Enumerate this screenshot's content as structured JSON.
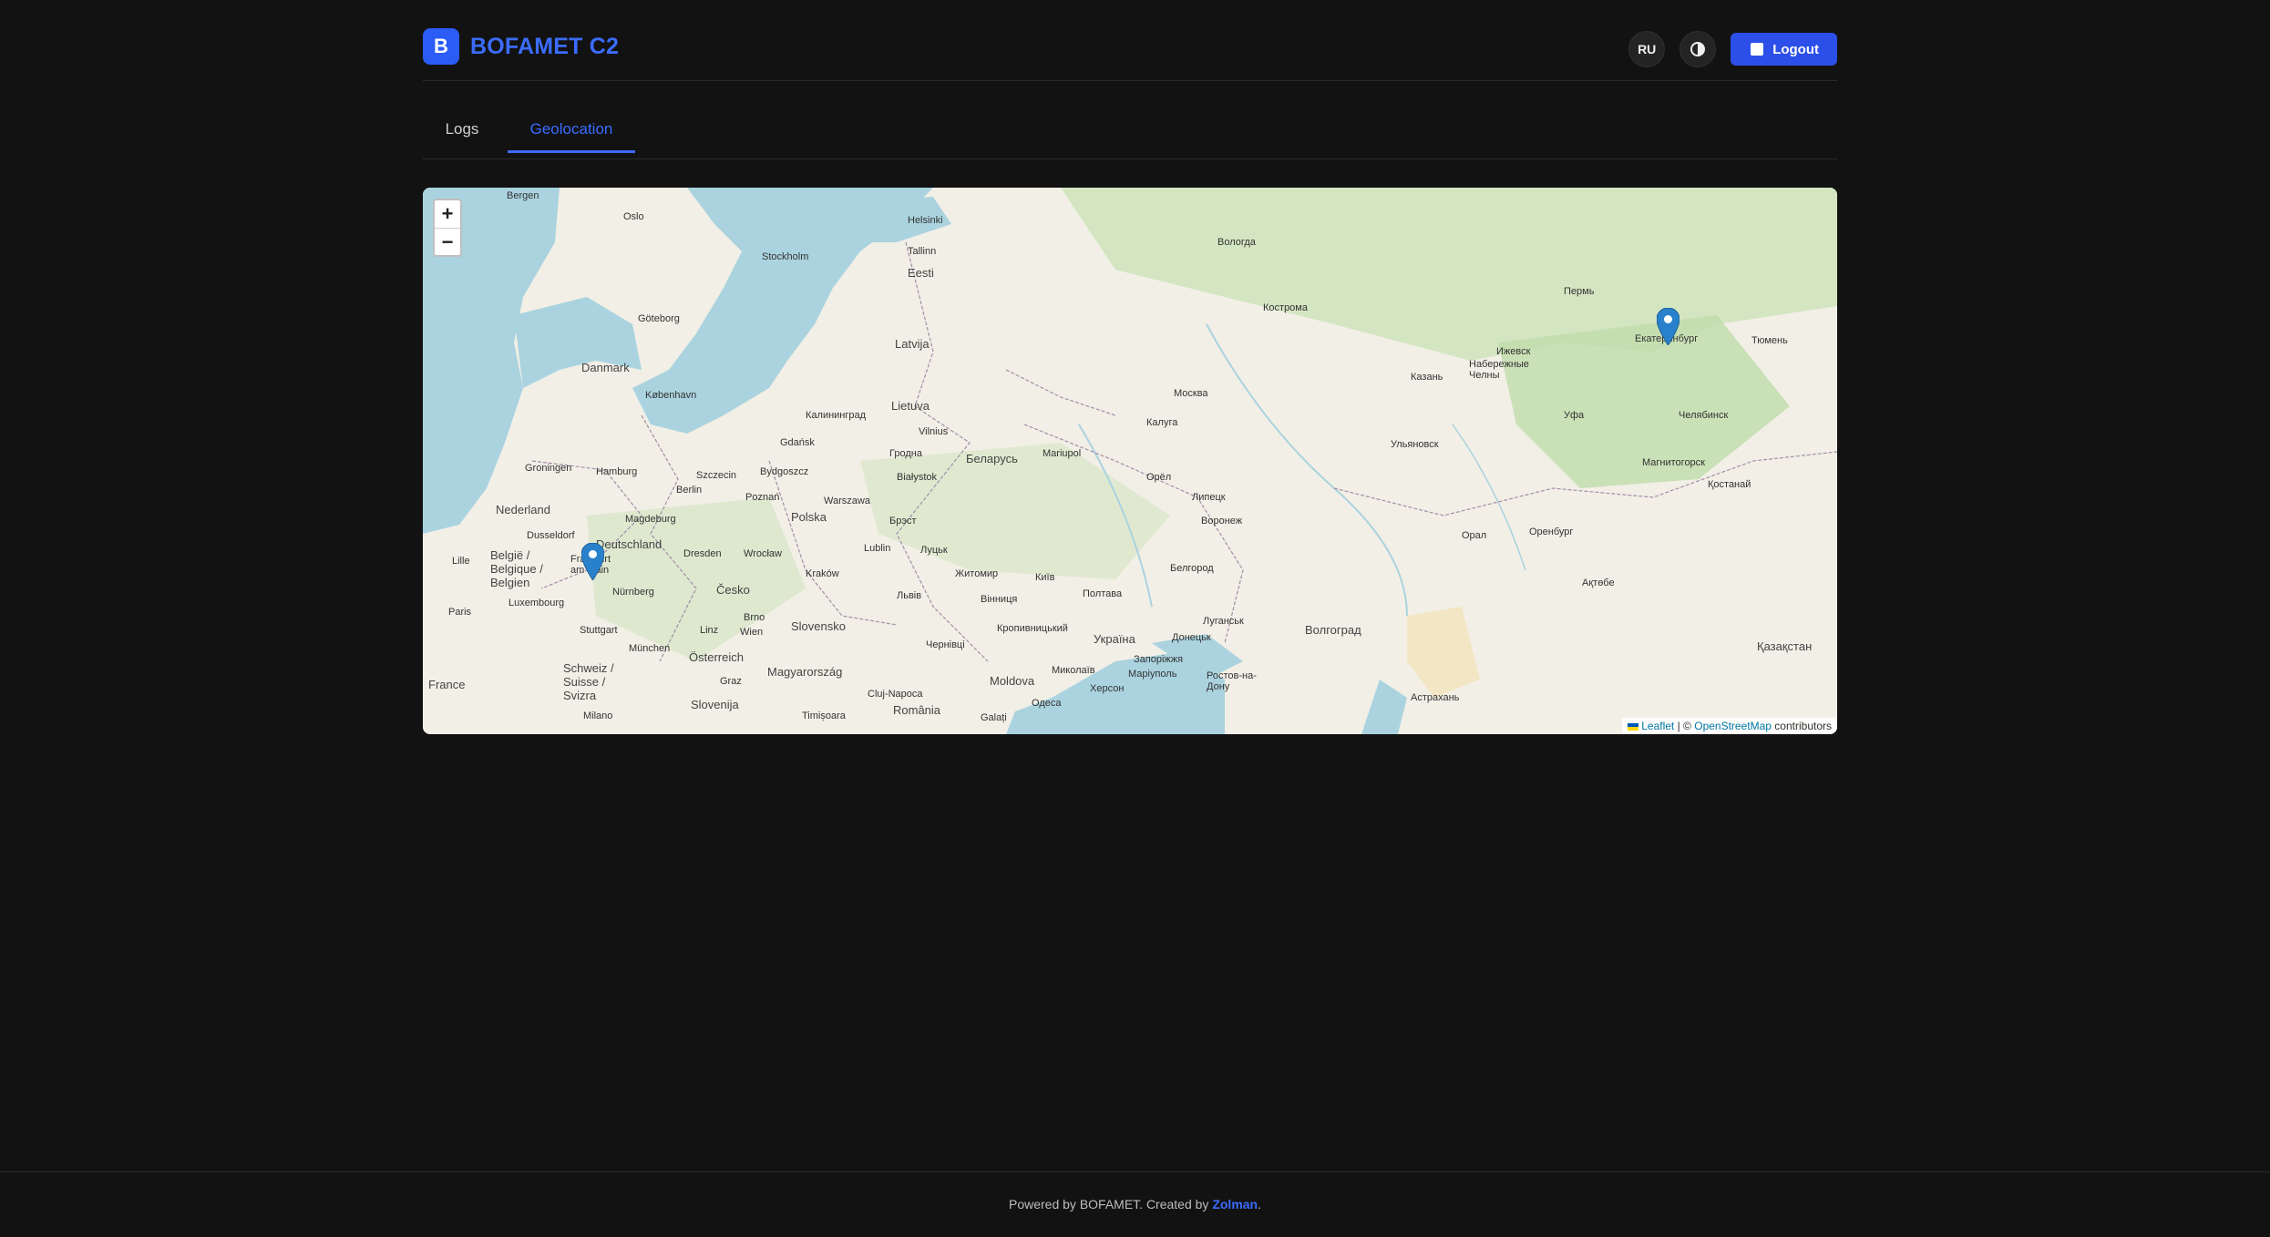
{
  "brand": {
    "badge": "B",
    "title": "BOFAMET C2"
  },
  "header": {
    "lang_button": "RU",
    "theme_toggle": "theme-toggle",
    "logout_label": "Logout"
  },
  "tabs": [
    {
      "label": "Logs",
      "active": false
    },
    {
      "label": "Geolocation",
      "active": true
    }
  ],
  "map": {
    "zoom_in": "+",
    "zoom_out": "−",
    "attribution": {
      "leaflet": "Leaflet",
      "sep": "| ©",
      "osm": "OpenStreetMap",
      "suffix": "contributors"
    },
    "markers": [
      {
        "near": "Frankfurt am Main"
      },
      {
        "near": "Екатеринбург"
      }
    ],
    "labels": {
      "bergen": "Bergen",
      "oslo": "Oslo",
      "stockholm": "Stockholm",
      "helsinki": "Helsinki",
      "tallinn": "Tallinn",
      "eesti": "Eesti",
      "goteborg": "Göteborg",
      "latvija": "Latvija",
      "danmark": "Danmark",
      "kobenhavn": "København",
      "lietuva": "Lietuva",
      "vilnius": "Vilnius",
      "kaliningrad": "Калининград",
      "gdansk": "Gdańsk",
      "hamburg": "Hamburg",
      "groningen": "Groningen",
      "nederland": "Nederland",
      "berlin": "Berlin",
      "szczecin": "Szczecin",
      "bydgoszcz": "Bydgoszcz",
      "poznan": "Poznań",
      "warszawa": "Warszawa",
      "polska": "Polska",
      "bialystok": "Białystok",
      "grodno": "Гродна",
      "belarus": "Беларусь",
      "magdeburg": "Magdeburg",
      "dusseldorf": "Dusseldorf",
      "deutschland": "Deutschland",
      "belgie": "België / Belgique / Belgien",
      "frankfurt": "Frankfurt am Main",
      "dresden": "Dresden",
      "wroclaw": "Wrocław",
      "lublin": "Lublin",
      "brest": "Брэст",
      "lutsk": "Луцьк",
      "zhytomyr": "Житомир",
      "kyiv": "Київ",
      "krakow": "Kraków",
      "lviv": "Львів",
      "vinnytsia": "Вінниця",
      "luxembourg": "Luxembourg",
      "nurnberg": "Nürnberg",
      "cesko": "Česko",
      "paris": "Paris",
      "stuttgart": "Stuttgart",
      "munchen": "München",
      "linz": "Linz",
      "wien": "Wien",
      "brno": "Brno",
      "slovensko": "Slovensko",
      "osterreich": "Österreich",
      "schweiz": "Schweiz / Suisse / Svizra",
      "france": "France",
      "graz": "Graz",
      "magyarorszag": "Magyarország",
      "slovenija": "Slovenija",
      "milano": "Milano",
      "timisoara": "Timișoara",
      "cluj": "Cluj-Napoca",
      "romania": "România",
      "chernivtsi": "Чернівці",
      "kropyvnytskyi": "Кропивницький",
      "moldova": "Moldova",
      "galati": "Galați",
      "odesa": "Одеса",
      "mykolaiv": "Миколаїв",
      "kherson": "Херсон",
      "zaporizhzhia": "Запоріжжя",
      "mariupol": "Маріуполь",
      "ukraina": "Україна",
      "poltava": "Полтава",
      "donetsk": "Донецьк",
      "luhansk": "Луганськ",
      "rostov": "Ростов-на-Дону",
      "belgorod": "Белгород",
      "voronezh": "Воронеж",
      "volgograd": "Волгоград",
      "astrakhan": "Астрахань",
      "lipetsk": "Липецк",
      "orel": "Орёл",
      "kaluga": "Калуга",
      "moskva": "Москва",
      "vologda": "Вологда",
      "kostroma": "Кострома",
      "mariupol2": "Marupol",
      "mariinsk": "Mariupol",
      "kazan": "Казань",
      "ulyanovsk": "Ульяновск",
      "izhevsk": "Ижевск",
      "naberezhnye": "Набережные Челны",
      "perm": "Пермь",
      "ekaterinburg": "Екатеринбург",
      "tyumen": "Тюмень",
      "ufa": "Уфа",
      "chelyabinsk": "Челябинск",
      "magnitogorsk": "Магнитогорск",
      "kostanai": "Қостанай",
      "orsk": "Орал",
      "orenburg": "Оренбург",
      "aktobe": "Ақтөбе",
      "kazakhstan": "Қазақстан",
      "lille": "Lille"
    }
  }
}
